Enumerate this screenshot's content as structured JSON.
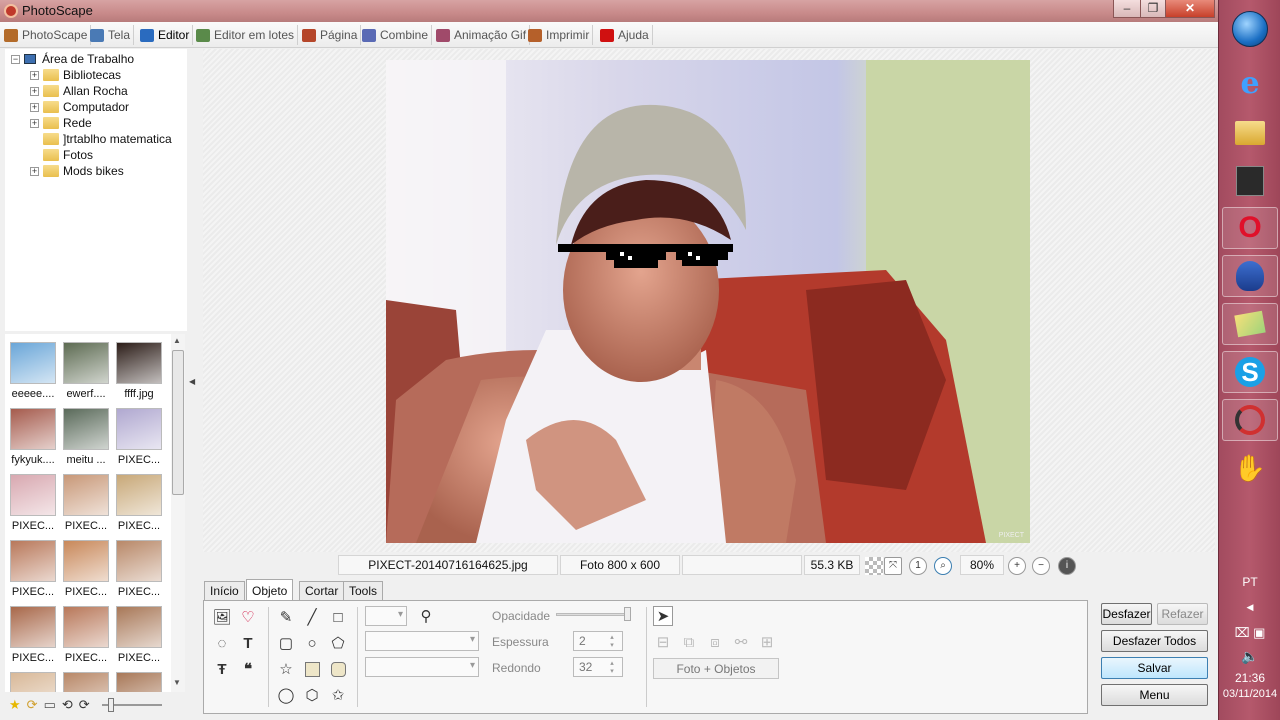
{
  "window": {
    "title": "PhotoScape"
  },
  "menu": {
    "tabs": [
      {
        "label": "PhotoScape",
        "color": "#b36b2a"
      },
      {
        "label": "Tela",
        "color": "#4a7ab5"
      },
      {
        "label": "Editor",
        "color": "#2a6bbf"
      },
      {
        "label": "Editor em lotes",
        "color": "#5a8a4a"
      },
      {
        "label": "Página",
        "color": "#b5462a"
      },
      {
        "label": "Combine",
        "color": "#5a6ab5"
      },
      {
        "label": "Animação Gif",
        "color": "#a04a6a"
      },
      {
        "label": "Imprimir",
        "color": "#b5602a"
      },
      {
        "label": "Ajuda",
        "color": "#d01010"
      }
    ],
    "active": "Editor"
  },
  "tree": {
    "root": "Área de Trabalho",
    "items": [
      {
        "label": "Bibliotecas",
        "expandable": true
      },
      {
        "label": "Allan Rocha",
        "expandable": true
      },
      {
        "label": "Computador",
        "expandable": true
      },
      {
        "label": "Rede",
        "expandable": true
      },
      {
        "label": "]trtablho matematica",
        "expandable": false
      },
      {
        "label": "Fotos",
        "expandable": false
      },
      {
        "label": "Mods bikes",
        "expandable": true
      }
    ]
  },
  "thumbnails": [
    {
      "label": "eeeee....",
      "color": "#6aa6d8"
    },
    {
      "label": "ewerf....",
      "color": "#5d6b52"
    },
    {
      "label": "ffff.jpg",
      "color": "#2c1d18"
    },
    {
      "label": "fykyuk....",
      "color": "#a55b4d"
    },
    {
      "label": "meitu ...",
      "color": "#5a6a5a"
    },
    {
      "label": "PIXEC...",
      "color": "#b0a8d0"
    },
    {
      "label": "PIXEC...",
      "color": "#d8a8b0"
    },
    {
      "label": "PIXEC...",
      "color": "#c89878"
    },
    {
      "label": "PIXEC...",
      "color": "#c8a878"
    },
    {
      "label": "PIXEC...",
      "color": "#b8785a"
    },
    {
      "label": "PIXEC...",
      "color": "#c8885a"
    },
    {
      "label": "PIXEC...",
      "color": "#b88868"
    },
    {
      "label": "PIXEC...",
      "color": "#a8684a"
    },
    {
      "label": "PIXEC...",
      "color": "#b8785a"
    },
    {
      "label": "PIXEC...",
      "color": "#a87858"
    },
    {
      "label": "",
      "color": "#d8b898"
    },
    {
      "label": "",
      "color": "#b88868"
    },
    {
      "label": "",
      "color": "#a87858"
    }
  ],
  "status": {
    "filename": "PIXECT-20140716164625.jpg",
    "dimensions": "Foto 800 x 600",
    "filesize": "55.3 KB",
    "zoom": "80%"
  },
  "photo_watermark": "PIXECT",
  "tabs": [
    "Início",
    "Objeto",
    "Cortar",
    "Tools"
  ],
  "active_tab": "Objeto",
  "object_panel": {
    "opacity_label": "Opacidade",
    "thickness_label": "Espessura",
    "thickness_value": "2",
    "round_label": "Redondo",
    "round_value": "32",
    "photo_objects_button": "Foto + Objetos"
  },
  "actions": {
    "undo": "Desfazer",
    "redo": "Refazer",
    "undo_all": "Desfazer Todos",
    "save": "Salvar",
    "menu": "Menu"
  },
  "taskbar": {
    "lang": "PT",
    "time": "21:36",
    "date": "03/11/2014"
  }
}
